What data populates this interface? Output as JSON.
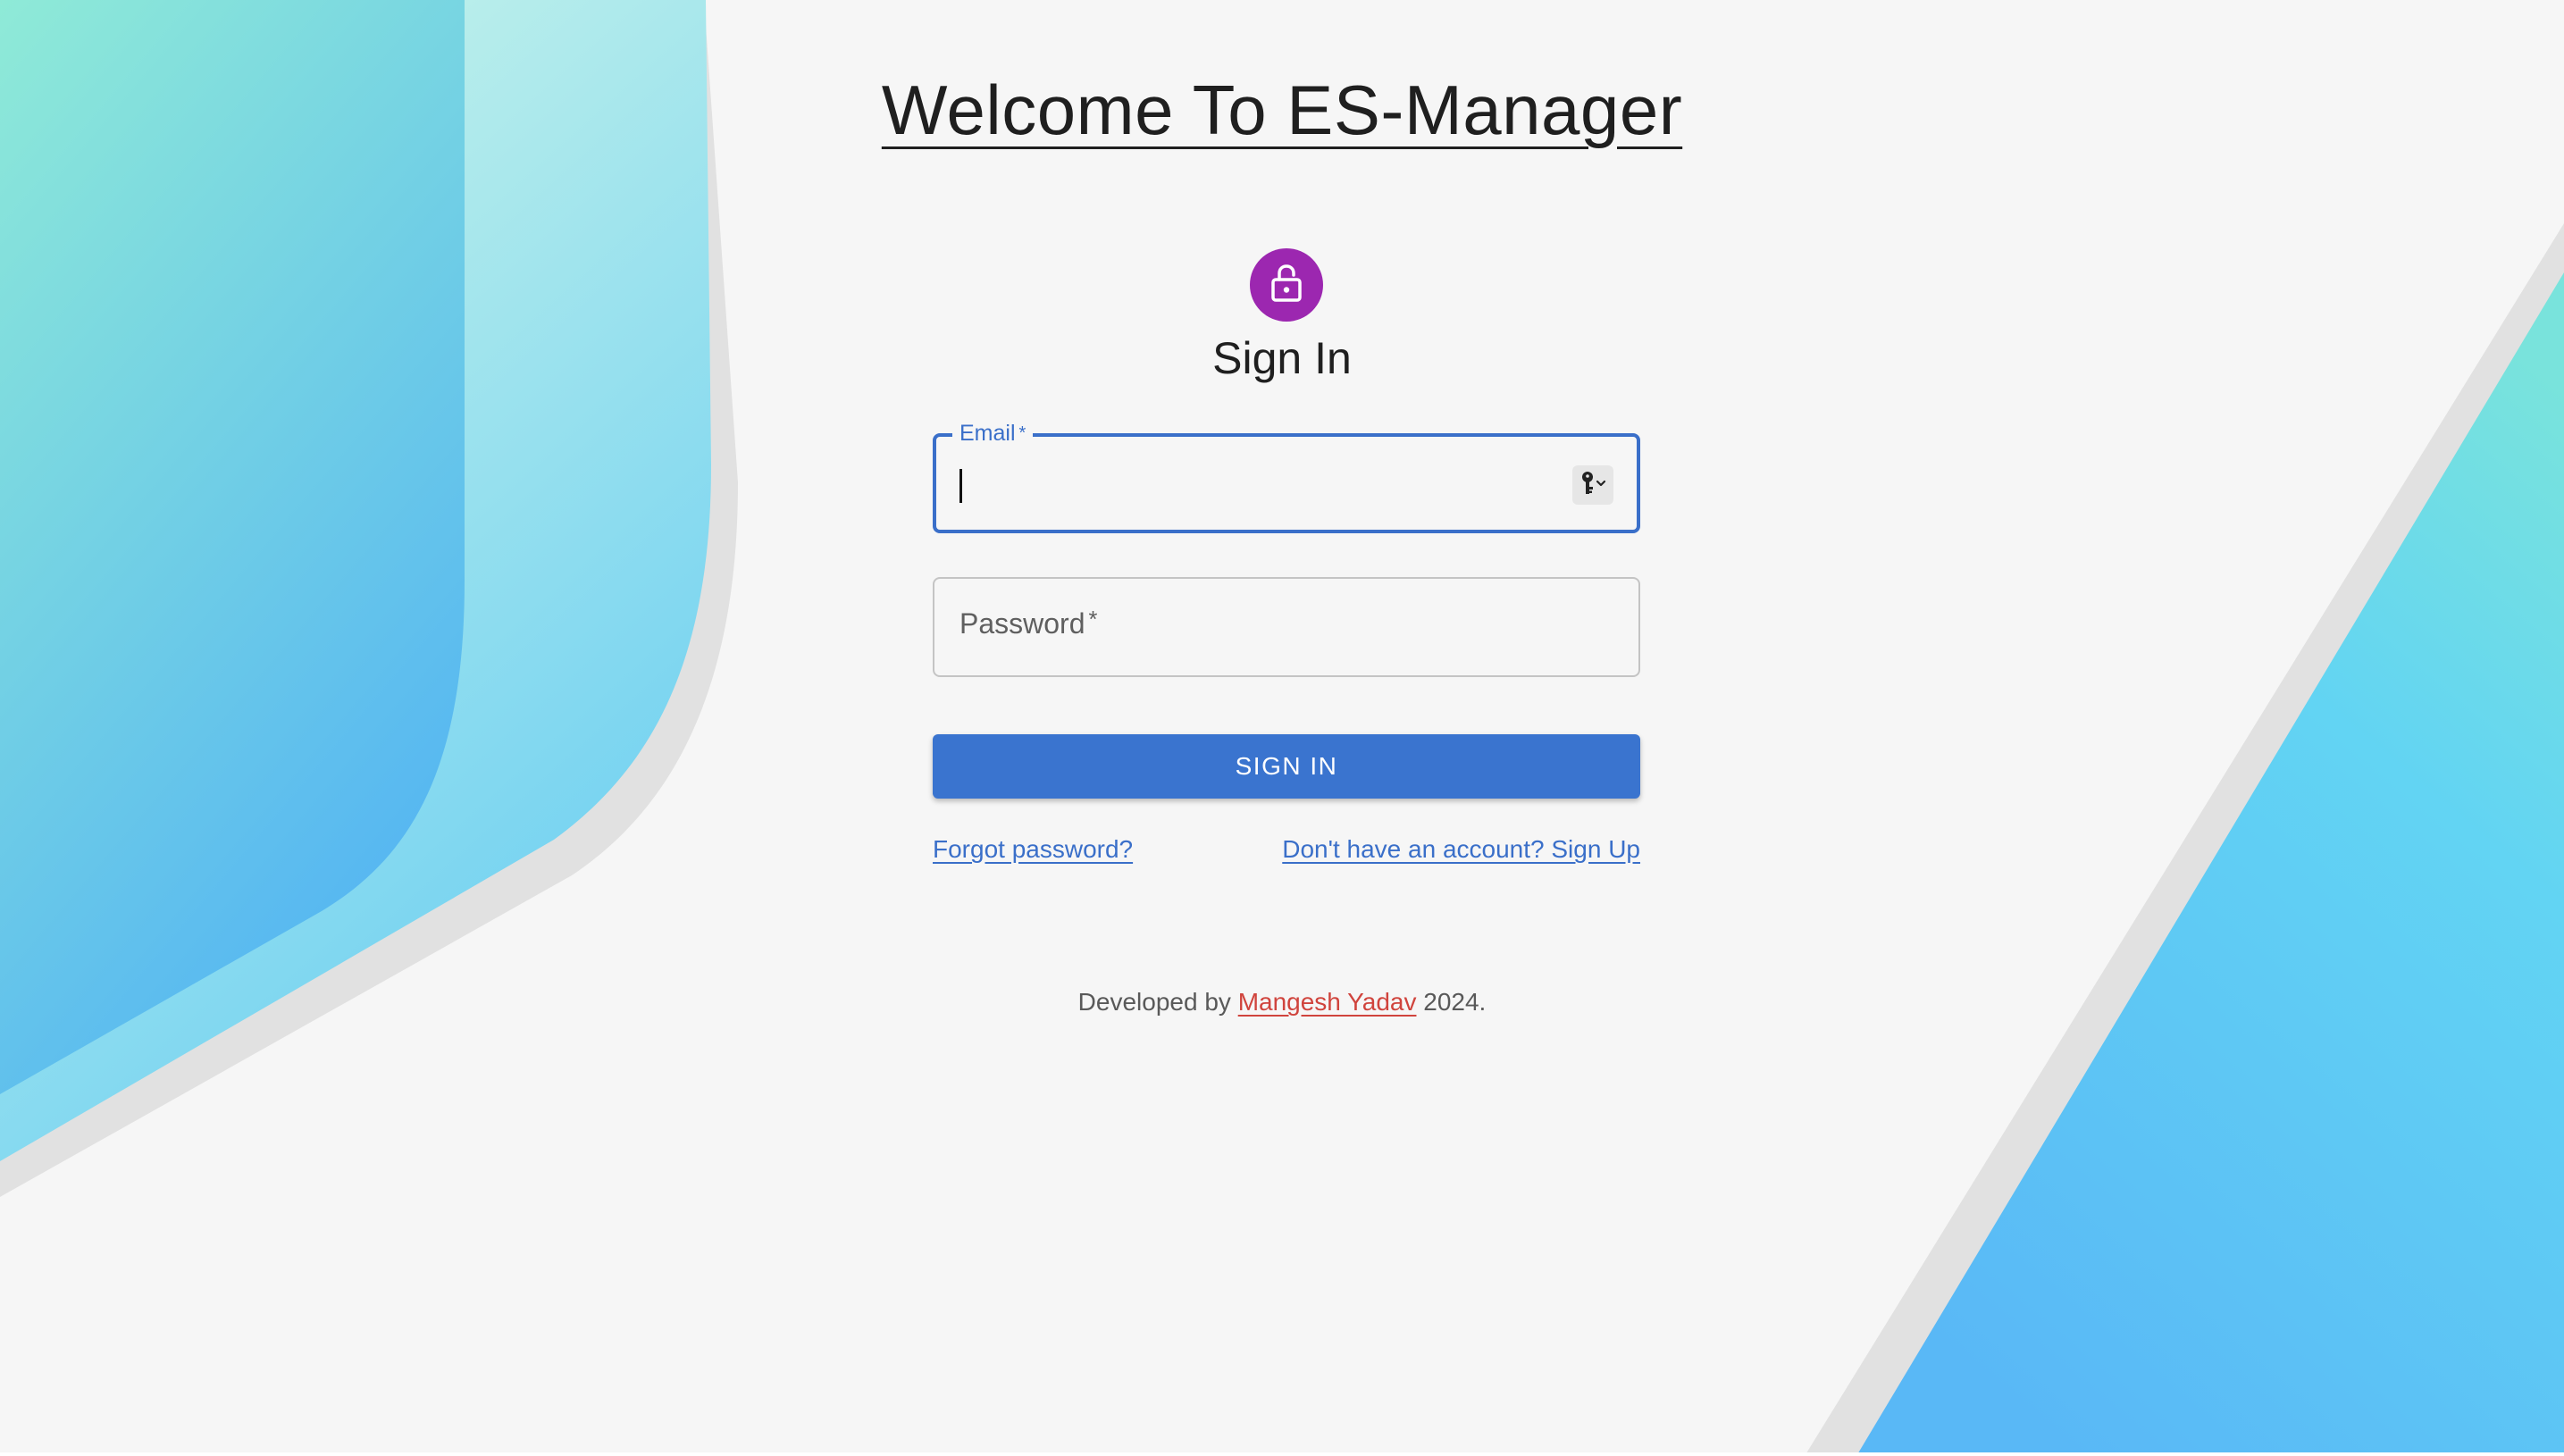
{
  "page": {
    "title": "Welcome To ES-Manager",
    "heading": "Sign In"
  },
  "form": {
    "email": {
      "label": "Email",
      "required_mark": "*",
      "value": ""
    },
    "password": {
      "label": "Password",
      "required_mark": "*",
      "value": ""
    },
    "submit_label": "SIGN IN"
  },
  "links": {
    "forgot_password": "Forgot password?",
    "sign_up": "Don't have an account? Sign Up"
  },
  "footer": {
    "prefix": "Developed by",
    "author": "Mangesh Yadav",
    "suffix": "2024."
  },
  "icons": {
    "avatar": "lock-icon",
    "password_manager": "key-icon"
  },
  "colors": {
    "primary": "#3a74cf",
    "avatar": "#9c27b0",
    "author_link": "#d0443d",
    "background": "#f6f6f6",
    "gradient_start": "#9beed3",
    "gradient_end": "#56b6f2"
  }
}
